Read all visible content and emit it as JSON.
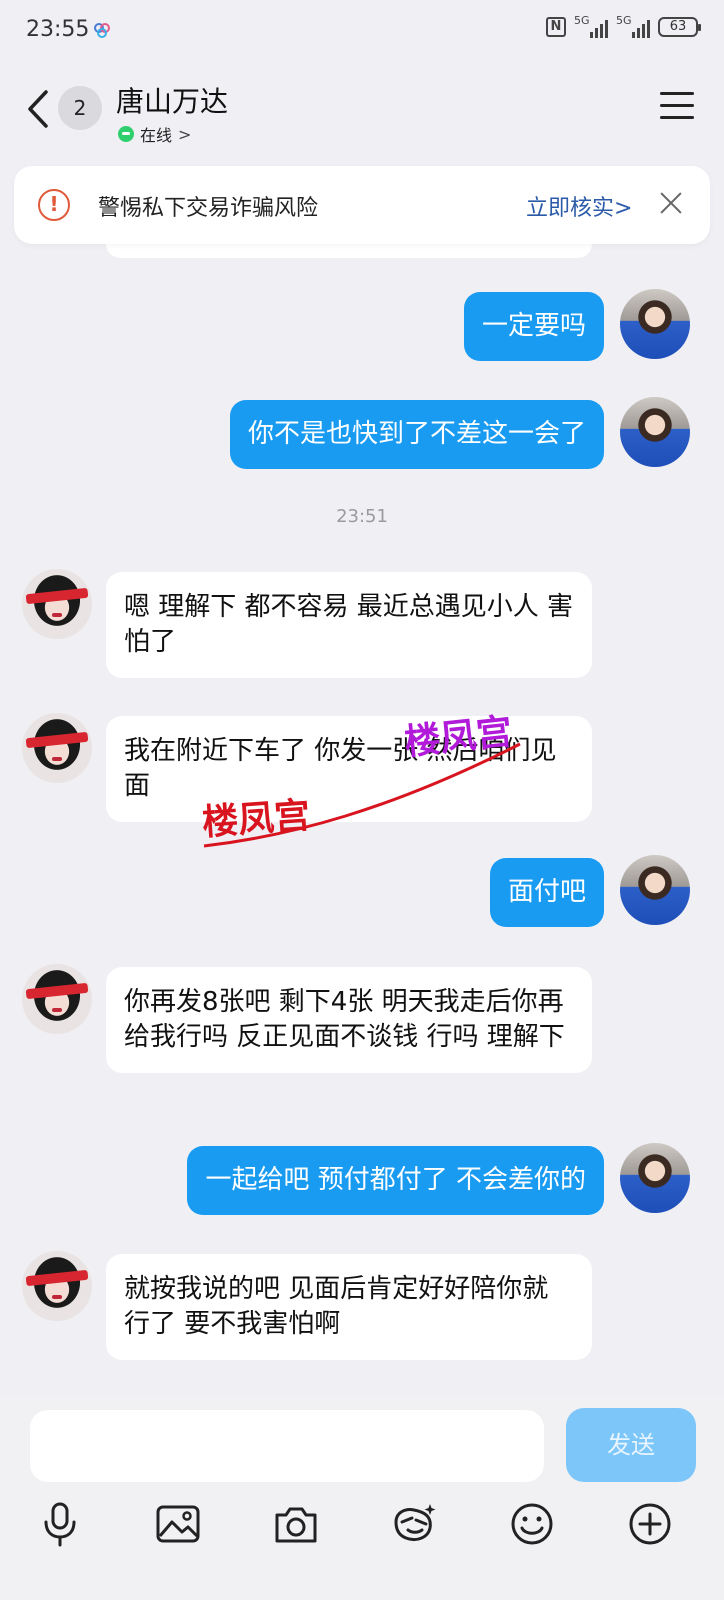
{
  "status_bar": {
    "time": "23:55",
    "network_1": "5G",
    "network_2": "5G",
    "battery": "63"
  },
  "header": {
    "unread_count": "2",
    "title": "唐山万达",
    "status": "在线",
    "status_chevron": ">"
  },
  "warning": {
    "text": "警惕私下交易诈骗风险",
    "action": "立即核实>"
  },
  "timestamp": "23:51",
  "messages": [
    {
      "from": "me",
      "text": "一定要吗"
    },
    {
      "from": "me",
      "text": "你不是也快到了不差这一会了"
    },
    {
      "from": "her",
      "text": "嗯 理解下 都不容易 最近总遇见小人 害怕了"
    },
    {
      "from": "her",
      "text": "我在附近下车了 你发一张 然后咱们见面"
    },
    {
      "from": "me",
      "text": "面付吧"
    },
    {
      "from": "her",
      "text": "你再发8张吧 剩下4张 明天我走后你再给我行吗 反正见面不谈钱 行吗 理解下"
    },
    {
      "from": "me",
      "text": "一起给吧 预付都付了 不会差你的"
    },
    {
      "from": "her",
      "text": "就按我说的吧 见面后肯定好好陪你就行了 要不我害怕啊"
    }
  ],
  "watermark": {
    "text": "楼凤宫"
  },
  "composer": {
    "input_value": "",
    "send_label": "发送"
  },
  "toolbar": [
    "microphone-icon",
    "image-icon",
    "camera-icon",
    "sticker-icon",
    "emoji-icon",
    "plus-icon"
  ],
  "colors": {
    "my_bubble": "#1a9bf2",
    "send_button": "#7cc6fa",
    "warning_icon": "#e05a3a",
    "verify_link": "#2b5aa8",
    "online_dot": "#2fcf6e"
  }
}
